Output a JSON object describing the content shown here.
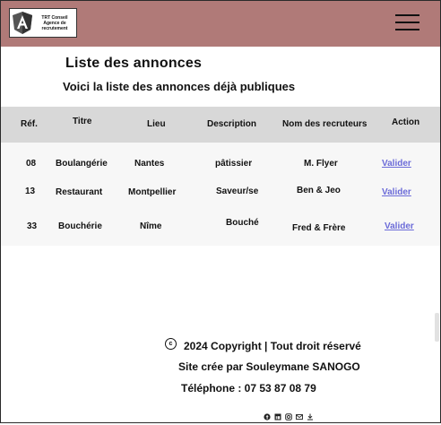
{
  "header": {
    "logo_text_lines": [
      "TRT Conseil",
      "Agence de",
      "recrutement"
    ],
    "menu_icon": "hamburger-menu-icon"
  },
  "page": {
    "title": "Liste des annonces",
    "subtitle": "Voici la liste des annonces déjà publiques"
  },
  "table": {
    "columns": [
      "Réf.",
      "Titre",
      "Lieu",
      "Description",
      "Nom des recruteurs",
      "Action"
    ],
    "rows": [
      {
        "ref": "08",
        "titre": "Boulangérie",
        "lieu": "Nantes",
        "description": "pâtissier",
        "recruteurs": "M. Flyer",
        "action": "Valider"
      },
      {
        "ref": "13",
        "titre": "Restaurant",
        "lieu": "Montpellier",
        "description": "Saveur/se",
        "recruteurs": "Ben & Jeo",
        "action": "Valider"
      },
      {
        "ref": "33",
        "titre": "Bouchérie",
        "lieu": "Nîme",
        "description": "Bouché",
        "recruteurs": "Fred & Frère",
        "action": "Valider"
      }
    ]
  },
  "footer": {
    "copyright": "2024 Copyright | Tout droit réservé",
    "credit": "Site crée par Souleymane SANOGO",
    "phone": "Téléphone : 07 53 87 08 79",
    "social_icons": [
      "facebook-icon",
      "linkedin-icon",
      "instagram-icon",
      "email-icon",
      "download-icon"
    ]
  }
}
